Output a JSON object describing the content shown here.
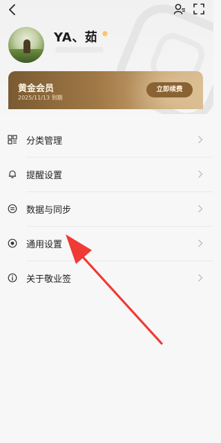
{
  "profile": {
    "username": "YA、茹",
    "vip_icon": "diamond-icon"
  },
  "membership": {
    "title": "黄金会员",
    "expiry": "2025/11/13 到期",
    "renew_label": "立即续费"
  },
  "topbar": {
    "back_icon": "back-arrow-icon",
    "user_icon": "user-settings-icon",
    "scan_icon": "scan-icon"
  },
  "menu": {
    "items": [
      {
        "label": "分类管理",
        "icon": "category-grid-icon"
      },
      {
        "label": "提醒设置",
        "icon": "bell-icon"
      },
      {
        "label": "数据与同步",
        "icon": "sync-icon"
      },
      {
        "label": "通用设置",
        "icon": "general-settings-icon"
      },
      {
        "label": "关于敬业签",
        "icon": "info-icon"
      }
    ]
  },
  "colors": {
    "accent_gold": "#a07846",
    "annotation_arrow": "#ee3b36"
  }
}
